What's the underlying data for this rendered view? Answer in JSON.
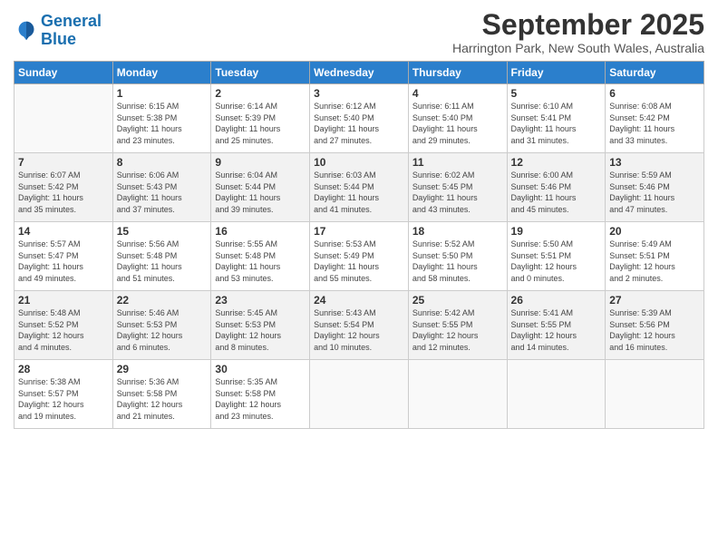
{
  "header": {
    "logo_line1": "General",
    "logo_line2": "Blue",
    "month_title": "September 2025",
    "location": "Harrington Park, New South Wales, Australia"
  },
  "weekdays": [
    "Sunday",
    "Monday",
    "Tuesday",
    "Wednesday",
    "Thursday",
    "Friday",
    "Saturday"
  ],
  "weeks": [
    [
      {
        "day": "",
        "info": ""
      },
      {
        "day": "1",
        "info": "Sunrise: 6:15 AM\nSunset: 5:38 PM\nDaylight: 11 hours\nand 23 minutes."
      },
      {
        "day": "2",
        "info": "Sunrise: 6:14 AM\nSunset: 5:39 PM\nDaylight: 11 hours\nand 25 minutes."
      },
      {
        "day": "3",
        "info": "Sunrise: 6:12 AM\nSunset: 5:40 PM\nDaylight: 11 hours\nand 27 minutes."
      },
      {
        "day": "4",
        "info": "Sunrise: 6:11 AM\nSunset: 5:40 PM\nDaylight: 11 hours\nand 29 minutes."
      },
      {
        "day": "5",
        "info": "Sunrise: 6:10 AM\nSunset: 5:41 PM\nDaylight: 11 hours\nand 31 minutes."
      },
      {
        "day": "6",
        "info": "Sunrise: 6:08 AM\nSunset: 5:42 PM\nDaylight: 11 hours\nand 33 minutes."
      }
    ],
    [
      {
        "day": "7",
        "info": "Sunrise: 6:07 AM\nSunset: 5:42 PM\nDaylight: 11 hours\nand 35 minutes."
      },
      {
        "day": "8",
        "info": "Sunrise: 6:06 AM\nSunset: 5:43 PM\nDaylight: 11 hours\nand 37 minutes."
      },
      {
        "day": "9",
        "info": "Sunrise: 6:04 AM\nSunset: 5:44 PM\nDaylight: 11 hours\nand 39 minutes."
      },
      {
        "day": "10",
        "info": "Sunrise: 6:03 AM\nSunset: 5:44 PM\nDaylight: 11 hours\nand 41 minutes."
      },
      {
        "day": "11",
        "info": "Sunrise: 6:02 AM\nSunset: 5:45 PM\nDaylight: 11 hours\nand 43 minutes."
      },
      {
        "day": "12",
        "info": "Sunrise: 6:00 AM\nSunset: 5:46 PM\nDaylight: 11 hours\nand 45 minutes."
      },
      {
        "day": "13",
        "info": "Sunrise: 5:59 AM\nSunset: 5:46 PM\nDaylight: 11 hours\nand 47 minutes."
      }
    ],
    [
      {
        "day": "14",
        "info": "Sunrise: 5:57 AM\nSunset: 5:47 PM\nDaylight: 11 hours\nand 49 minutes."
      },
      {
        "day": "15",
        "info": "Sunrise: 5:56 AM\nSunset: 5:48 PM\nDaylight: 11 hours\nand 51 minutes."
      },
      {
        "day": "16",
        "info": "Sunrise: 5:55 AM\nSunset: 5:48 PM\nDaylight: 11 hours\nand 53 minutes."
      },
      {
        "day": "17",
        "info": "Sunrise: 5:53 AM\nSunset: 5:49 PM\nDaylight: 11 hours\nand 55 minutes."
      },
      {
        "day": "18",
        "info": "Sunrise: 5:52 AM\nSunset: 5:50 PM\nDaylight: 11 hours\nand 58 minutes."
      },
      {
        "day": "19",
        "info": "Sunrise: 5:50 AM\nSunset: 5:51 PM\nDaylight: 12 hours\nand 0 minutes."
      },
      {
        "day": "20",
        "info": "Sunrise: 5:49 AM\nSunset: 5:51 PM\nDaylight: 12 hours\nand 2 minutes."
      }
    ],
    [
      {
        "day": "21",
        "info": "Sunrise: 5:48 AM\nSunset: 5:52 PM\nDaylight: 12 hours\nand 4 minutes."
      },
      {
        "day": "22",
        "info": "Sunrise: 5:46 AM\nSunset: 5:53 PM\nDaylight: 12 hours\nand 6 minutes."
      },
      {
        "day": "23",
        "info": "Sunrise: 5:45 AM\nSunset: 5:53 PM\nDaylight: 12 hours\nand 8 minutes."
      },
      {
        "day": "24",
        "info": "Sunrise: 5:43 AM\nSunset: 5:54 PM\nDaylight: 12 hours\nand 10 minutes."
      },
      {
        "day": "25",
        "info": "Sunrise: 5:42 AM\nSunset: 5:55 PM\nDaylight: 12 hours\nand 12 minutes."
      },
      {
        "day": "26",
        "info": "Sunrise: 5:41 AM\nSunset: 5:55 PM\nDaylight: 12 hours\nand 14 minutes."
      },
      {
        "day": "27",
        "info": "Sunrise: 5:39 AM\nSunset: 5:56 PM\nDaylight: 12 hours\nand 16 minutes."
      }
    ],
    [
      {
        "day": "28",
        "info": "Sunrise: 5:38 AM\nSunset: 5:57 PM\nDaylight: 12 hours\nand 19 minutes."
      },
      {
        "day": "29",
        "info": "Sunrise: 5:36 AM\nSunset: 5:58 PM\nDaylight: 12 hours\nand 21 minutes."
      },
      {
        "day": "30",
        "info": "Sunrise: 5:35 AM\nSunset: 5:58 PM\nDaylight: 12 hours\nand 23 minutes."
      },
      {
        "day": "",
        "info": ""
      },
      {
        "day": "",
        "info": ""
      },
      {
        "day": "",
        "info": ""
      },
      {
        "day": "",
        "info": ""
      }
    ]
  ]
}
